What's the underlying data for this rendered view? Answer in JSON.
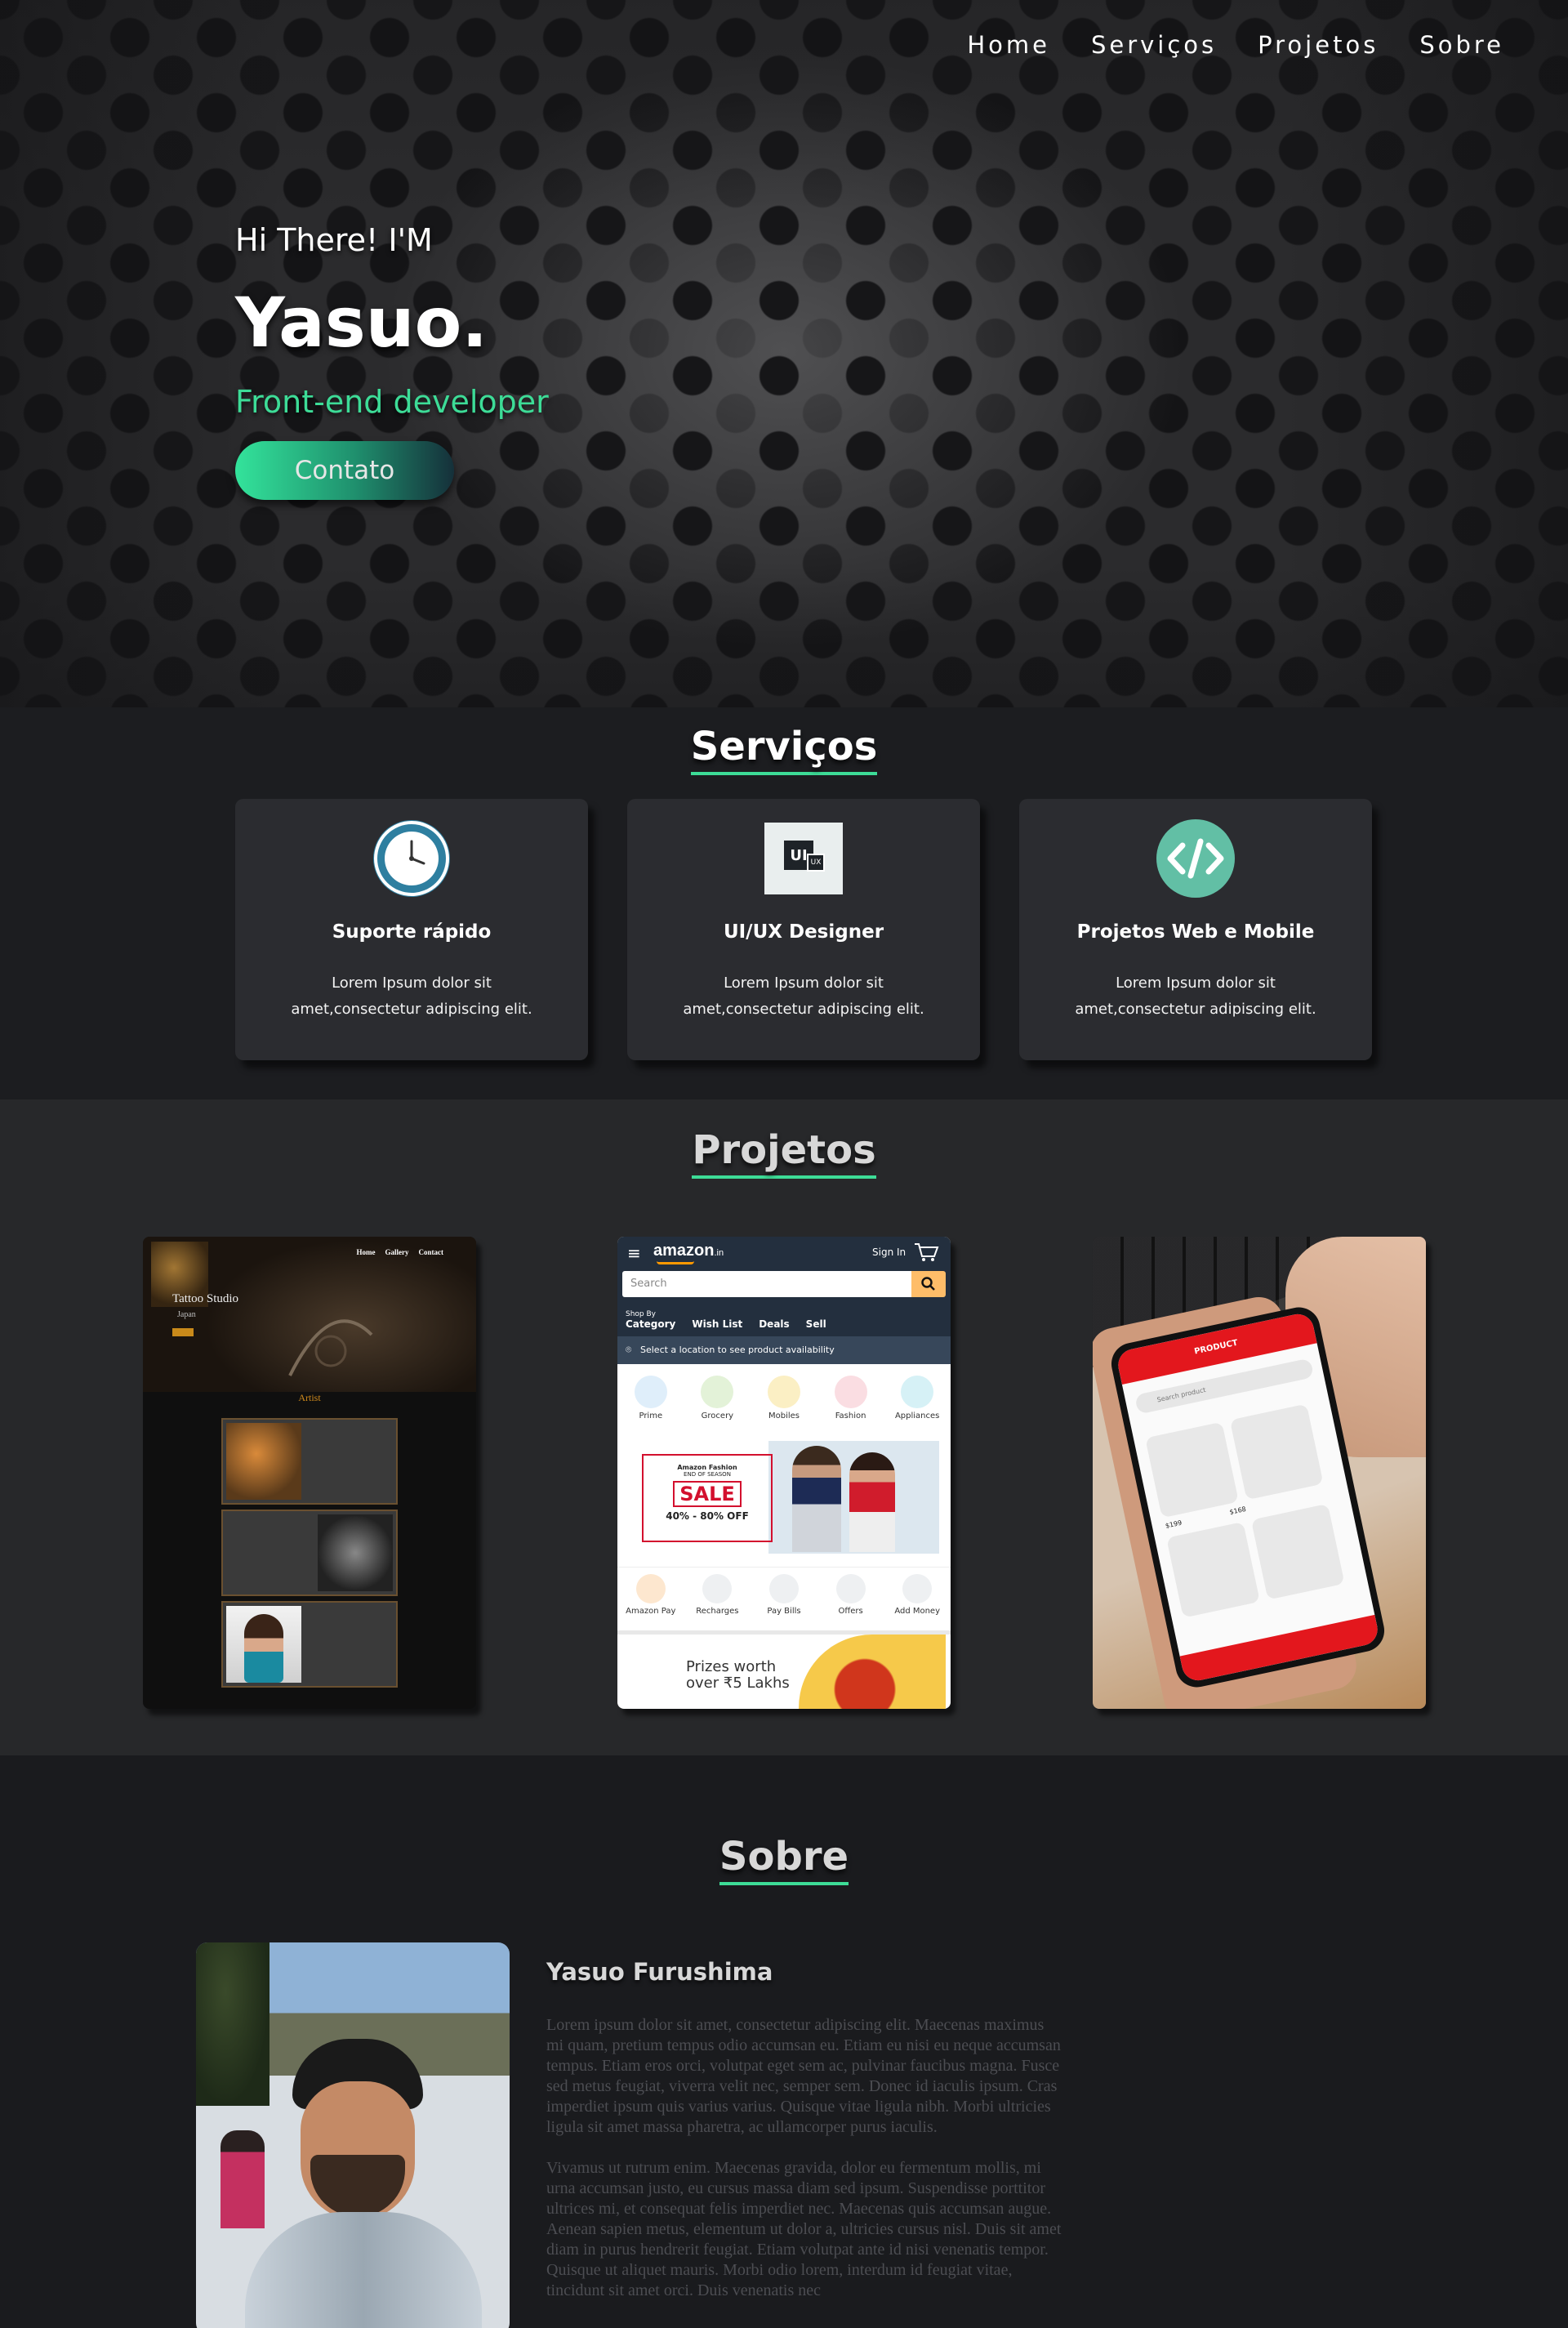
{
  "nav": {
    "items": [
      "Home",
      "Serviços",
      "Projetos",
      "Sobre"
    ]
  },
  "hero": {
    "greeting": "Hi There! I'M",
    "name": "Yasuo.",
    "role": "Front-end developer",
    "button_label": "Contato"
  },
  "services": {
    "title": "Serviços",
    "cards": [
      {
        "icon": "clock-icon",
        "title": "Suporte rápido",
        "description": "Lorem Ipsum dolor sit amet,consectetur adipiscing elit."
      },
      {
        "icon": "ui-ux-icon",
        "title": "UI/UX Designer",
        "description": "Lorem Ipsum dolor sit amet,consectetur adipiscing elit."
      },
      {
        "icon": "code-icon",
        "title": "Projetos Web e Mobile",
        "description": "Lorem Ipsum dolor sit amet,consectetur adipiscing elit."
      }
    ],
    "ui_icon_text": {
      "ui": "UI",
      "ux": "UX"
    }
  },
  "projects": {
    "title": "Projetos",
    "tattoo": {
      "logo": "Tattoo Studio",
      "menu": [
        "Home",
        "Gallery",
        "Contact"
      ],
      "sub": "Japan",
      "section": "Artist"
    },
    "amazon": {
      "brand": "amazon",
      "brand_suffix": ".in",
      "sign_in": "Sign In",
      "search_placeholder": "Search",
      "shop_by": "Shop By",
      "tabs": [
        "Category",
        "Wish List",
        "Deals",
        "Sell"
      ],
      "location": "Select a location to see product availability",
      "categories": [
        "Prime",
        "Grocery",
        "Mobiles",
        "Fashion",
        "Appliances"
      ],
      "banner_small": "Amazon Fashion",
      "banner_eos": "END OF SEASON",
      "banner_sale": "SALE",
      "banner_off": "40% - 80% OFF",
      "actions": [
        "Amazon Pay",
        "Recharges",
        "Pay Bills",
        "Offers",
        "Add Money"
      ],
      "prize_line1": "Prizes worth",
      "prize_line2": "over ₹5 Lakhs"
    },
    "mobile": {
      "header": "PRODUCT",
      "search": "Search product",
      "prices": [
        "$199",
        "$168"
      ]
    }
  },
  "about": {
    "title": "Sobre",
    "name": "Yasuo Furushima",
    "paragraph1": "Lorem ipsum dolor sit amet, consectetur adipiscing elit. Maecenas maximus mi quam, pretium tempus odio accumsan eu. Etiam eu nisi eu neque accumsan tempus. Etiam eros orci, volutpat eget sem ac, pulvinar faucibus magna. Fusce sed metus feugiat, viverra velit nec, semper sem. Donec id iaculis ipsum. Cras imperdiet ipsum quis varius varius. Quisque vitae ligula nibh. Morbi ultricies ligula sit amet massa pharetra, ac ullamcorper purus iaculis.",
    "paragraph2": "Vivamus ut rutrum enim. Maecenas gravida, dolor eu fermentum mollis, mi urna accumsan justo, eu cursus massa diam sed ipsum. Suspendisse porttitor ultrices mi, et consequat felis imperdiet nec. Maecenas quis accumsan augue. Aenean sapien metus, elementum ut dolor a, ultricies cursus nisl. Duis sit amet diam in purus hendrerit feugiat. Etiam volutpat ante id nisi venenatis tempor. Quisque ut aliquet mauris. Morbi odio lorem, interdum id feugiat vitae, tincidunt sit amet orci. Duis venenatis nec"
  },
  "colors": {
    "accent": "#3ddc97",
    "background": "#1a1b1e",
    "card": "#2b2c30",
    "amazon_orange": "#febd69"
  }
}
